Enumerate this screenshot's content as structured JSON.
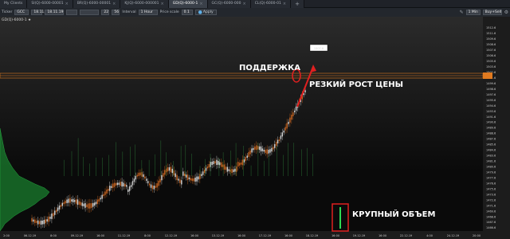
{
  "tabs": [
    {
      "label": "My Clients",
      "active": false
    },
    {
      "label": "SI(Q)-6000-00001",
      "active": false
    },
    {
      "label": "BR(Q)-6000-00001",
      "active": false
    },
    {
      "label": "KJ(Q)-6000-000001",
      "active": false
    },
    {
      "label": "GD(Q)-6000-1",
      "active": true
    },
    {
      "label": "GC(Q)-6000-000",
      "active": false
    },
    {
      "label": "CL(Q)-6000-01",
      "active": false
    }
  ],
  "toolbar": {
    "ticker_label": "Ticker",
    "ticker_value": "GCC",
    "from_value": "18.11.19",
    "to_value": "",
    "bars_value": "22",
    "bars2_value": "56",
    "interval_label": "Interval",
    "interval_value": "1 Hour",
    "price_scale_label": "Price scale",
    "price_scale_value": "0.1",
    "apply_label": "Apply",
    "timeframe_value": "1 Min",
    "mode_value": "Buy+Sell"
  },
  "chart": {
    "title": "GD(Q)-6000-1 ★",
    "price_tag": "1507.6",
    "annotations": {
      "support": "ПОДДЕРЖКА",
      "sharp_rise": "РЕЗКИЙ РОСТ ЦЕНЫ",
      "big_volume": "КРУПНЫЙ ОБЪЕМ"
    },
    "y_ticks": [
      "1512.6",
      "1511.6",
      "1509.6",
      "1508.6",
      "1507.6",
      "1506.6",
      "1505.6",
      "1503.6",
      "1502.6",
      "1501.6",
      "1499.6",
      "1498.6",
      "1497.6",
      "1495.6",
      "1494.6",
      "1493.6",
      "1491.6",
      "1490.6",
      "1489.6",
      "1488.6",
      "1487.6",
      "1485.6",
      "1484.6",
      "1483.6",
      "1481.6",
      "1480.6",
      "1479.6",
      "1477.6",
      "1476.6",
      "1475.6",
      "1473.6",
      "1472.6",
      "1471.6",
      "1469.6",
      "1468.6",
      "1467.6",
      "1466.6"
    ],
    "x_ticks": [
      "2:00",
      "06.12.19",
      "8:00",
      "09.12.19",
      "16:00",
      "11.12.19",
      "8:00",
      "12.12.19",
      "16:00",
      "13.12.19",
      "16:00",
      "17.12.19",
      "16:00",
      "18.12.19",
      "16:00",
      "19.12.19",
      "16:00",
      "22.12.19",
      "4:00",
      "24.12.19",
      "20:00"
    ],
    "colors": {
      "bull": "#c86420",
      "bear": "#d8d8d8",
      "volume_profile": "#1fa83a",
      "support_band": "#e07a20",
      "marker": "#e02020"
    }
  }
}
